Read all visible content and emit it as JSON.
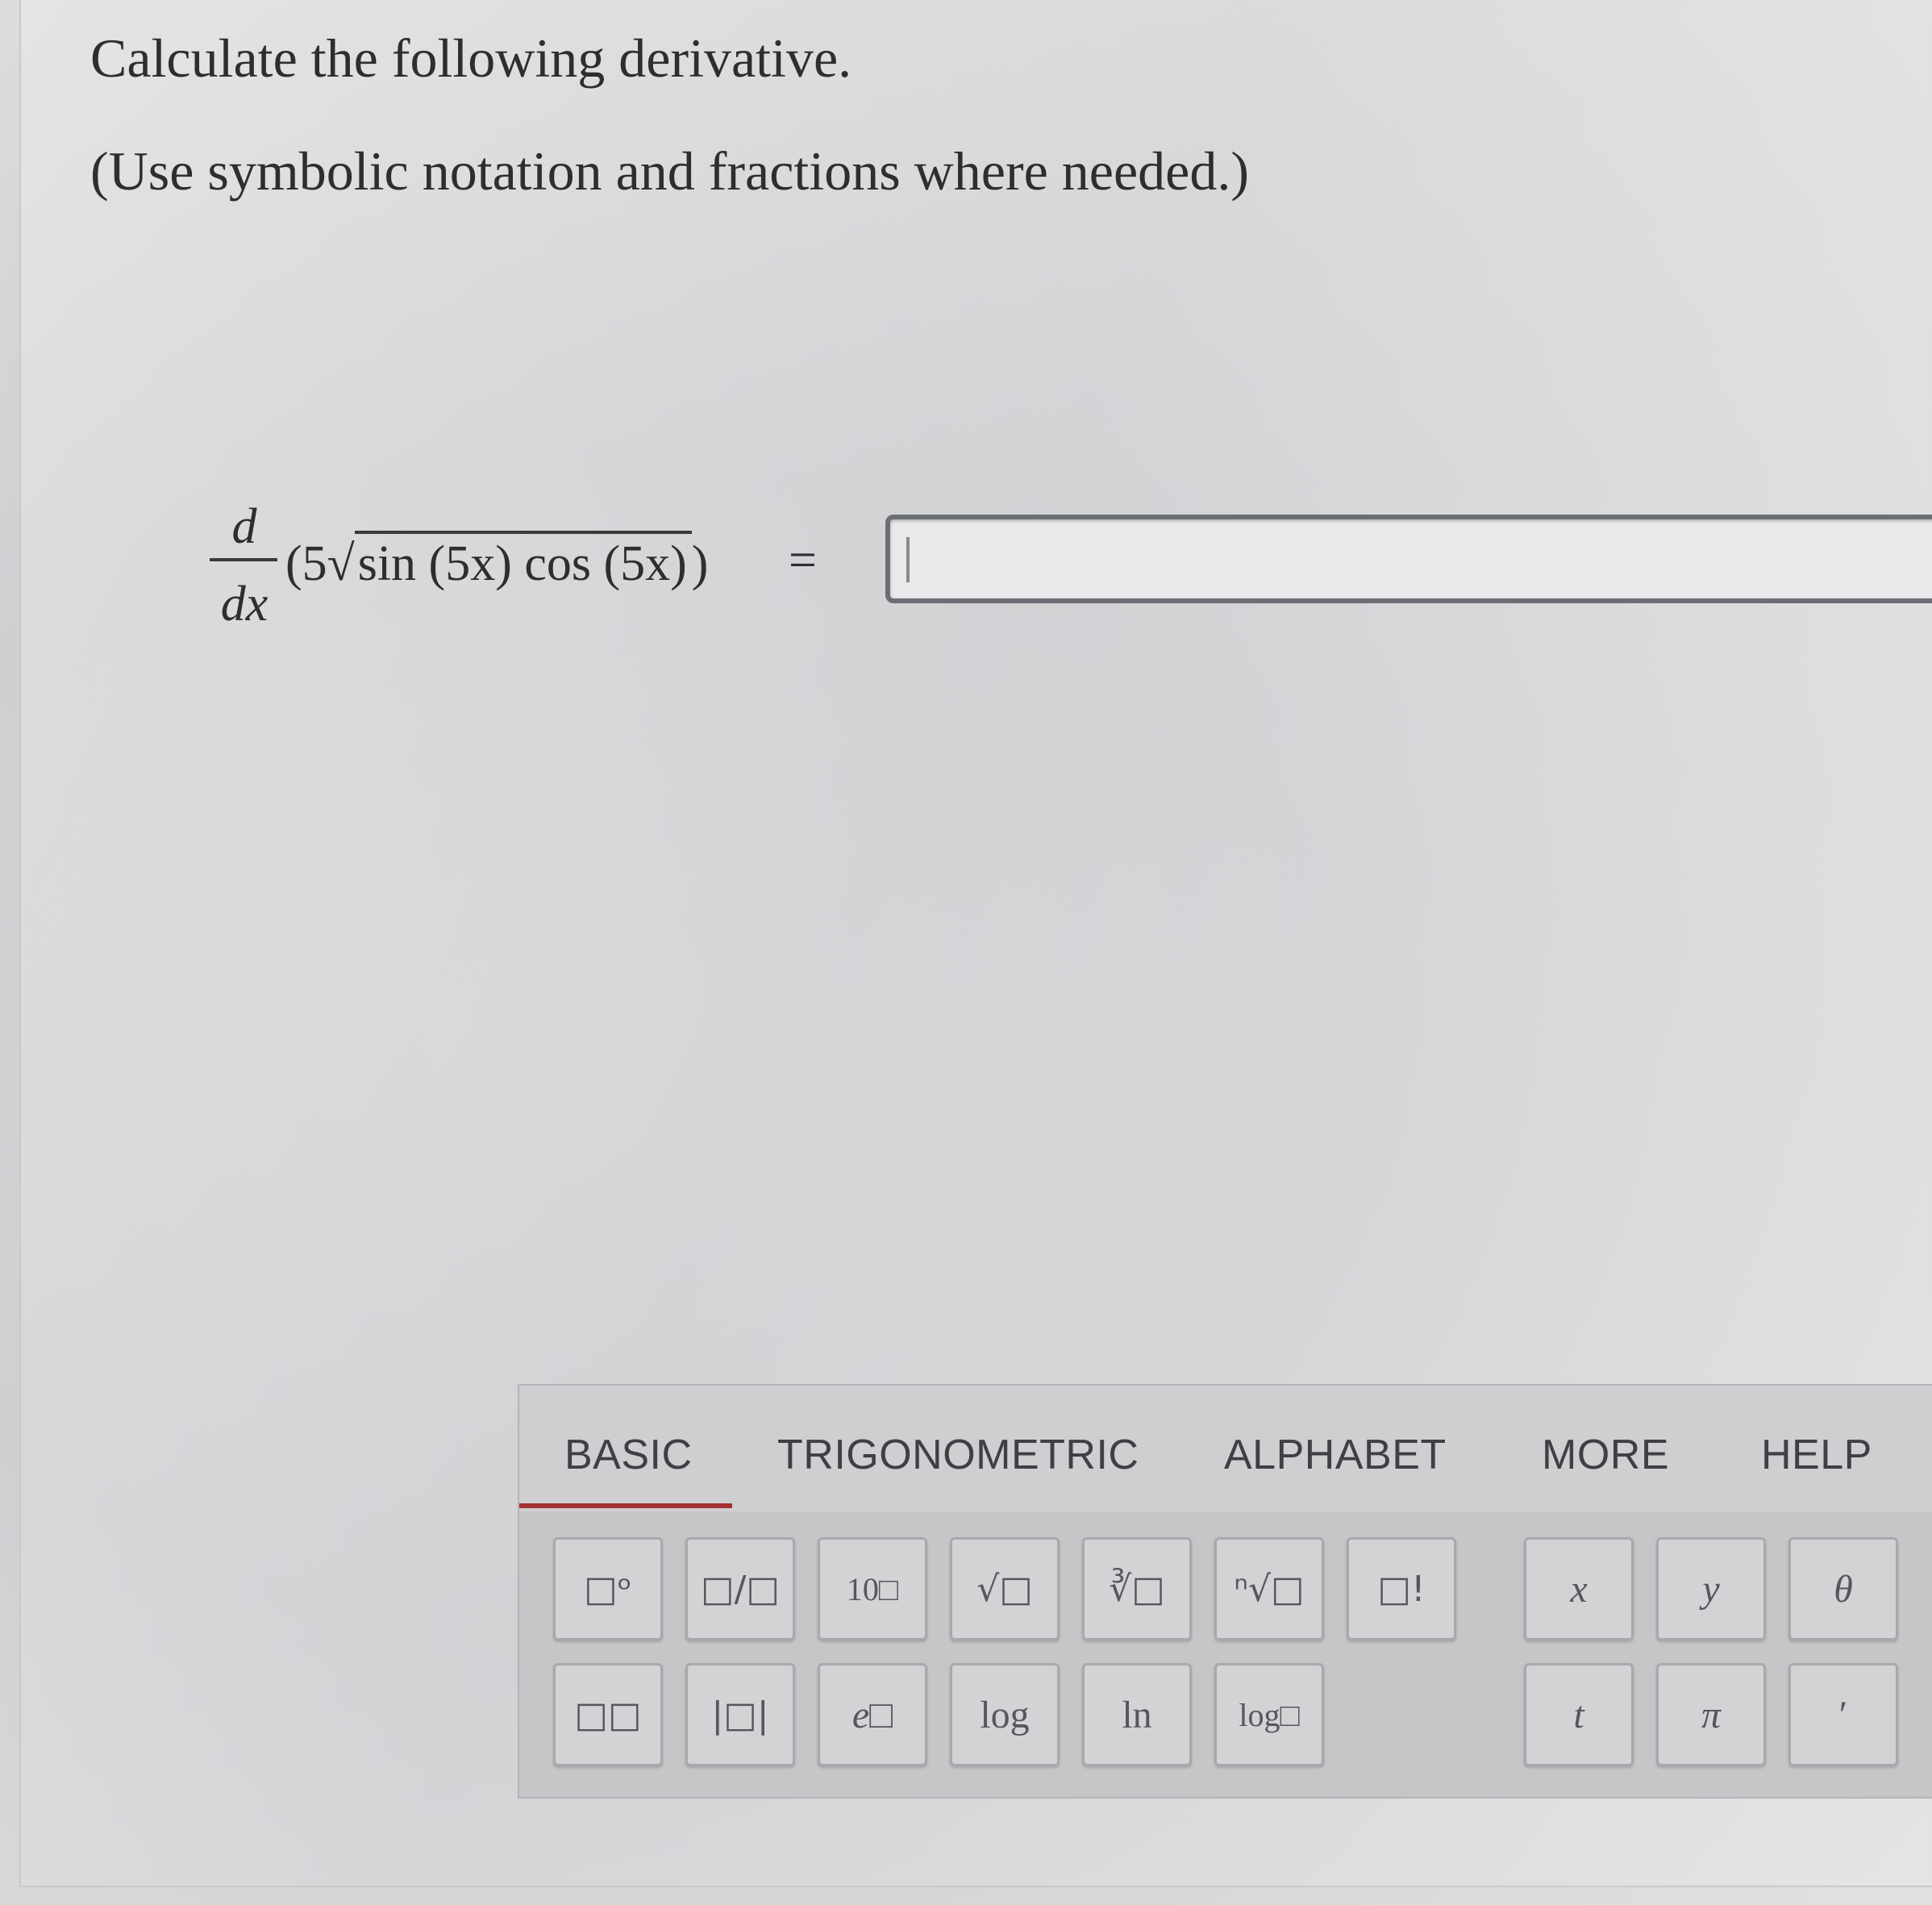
{
  "question": {
    "prompt": "Calculate the following derivative.",
    "instructions": "(Use symbolic notation and fractions where needed.)"
  },
  "equation": {
    "numerator": "d",
    "denominator": "dx",
    "open": "(5",
    "radicand": "sin (5x) cos (5x)",
    "close": ")",
    "equals": "="
  },
  "answer": {
    "value": ""
  },
  "palette": {
    "tabs": [
      "BASIC",
      "TRIGONOMETRIC",
      "ALPHABET",
      "MORE",
      "HELP"
    ],
    "active_tab": "BASIC",
    "accent_color": "#a2312f",
    "keys": {
      "power": "□ᵒ",
      "fraction": "□/□",
      "ten_power": "10□",
      "sqrt": "√□",
      "cube_root": "∛□",
      "nth_root": "ⁿ√□",
      "factorial": "□!",
      "x": "x",
      "y": "y",
      "theta": "θ",
      "subscript": "□□",
      "abs": "|□|",
      "exp": "e□",
      "log": "log",
      "ln": "ln",
      "log_base": "log□",
      "t": "t",
      "pi": "π",
      "prime": "′"
    }
  }
}
